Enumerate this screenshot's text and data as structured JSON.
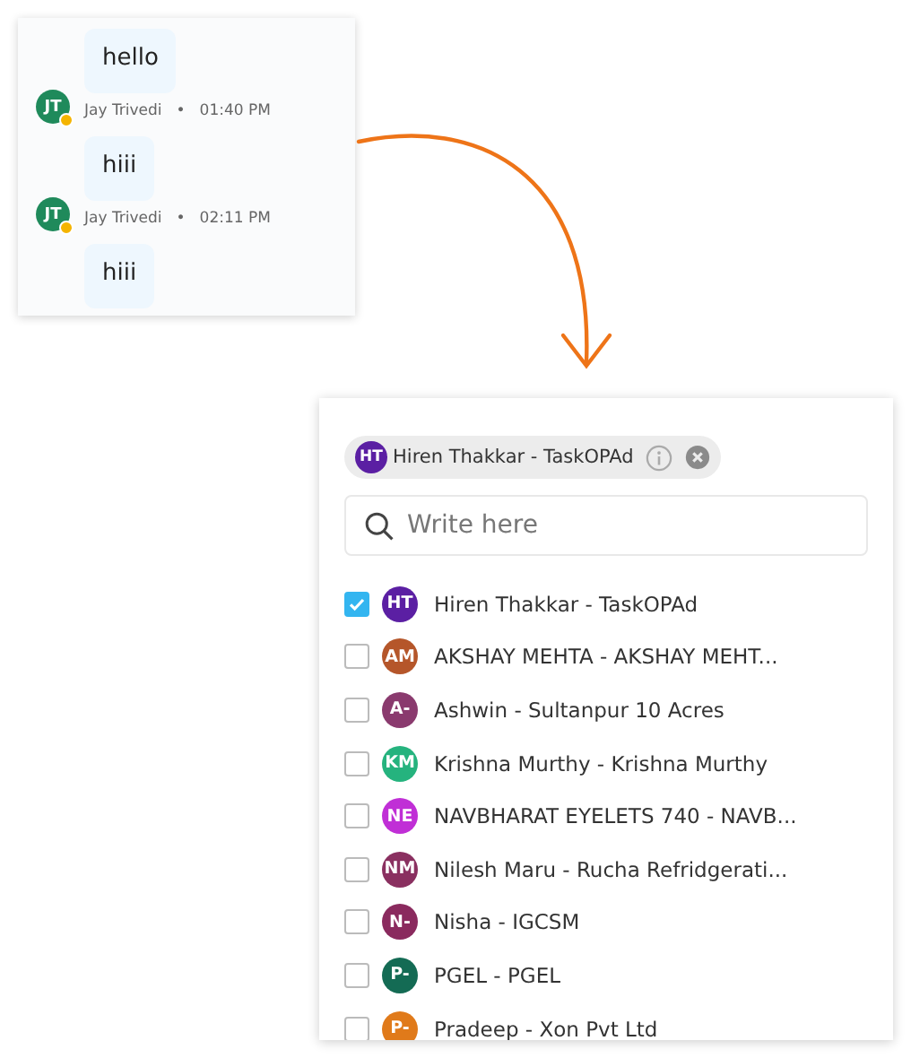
{
  "chat": {
    "messages": [
      {
        "text": "hello",
        "sender": {
          "initials": "JT",
          "name": "Jay Trivedi",
          "color": "#1f8a5b",
          "online": true
        },
        "separator": "•",
        "time": "01:40 PM"
      },
      {
        "text": "hiii",
        "sender": {
          "initials": "JT",
          "name": "Jay Trivedi",
          "color": "#1f8a5b",
          "online": true
        },
        "separator": "•",
        "time": "02:11 PM"
      },
      {
        "text": "hiii"
      }
    ]
  },
  "picker": {
    "chips": [
      {
        "initials": "HT",
        "label": "Hiren Thakkar - TaskOPAd",
        "color": "#5b1fa3"
      }
    ],
    "search": {
      "placeholder": "Write here"
    },
    "options": [
      {
        "initials": "HT",
        "label": "Hiren Thakkar - TaskOPAd",
        "color": "#5b1fa3",
        "checked": true
      },
      {
        "initials": "AM",
        "label": "AKSHAY MEHTA - AKSHAY MEHT...",
        "color": "#b5562a",
        "checked": false
      },
      {
        "initials": "A-",
        "label": "Ashwin - Sultanpur 10 Acres",
        "color": "#8a3a6e",
        "checked": false
      },
      {
        "initials": "KM",
        "label": "Krishna Murthy - Krishna Murthy",
        "color": "#25b37e",
        "checked": false
      },
      {
        "initials": "NE",
        "label": "NAVBHARAT EYELETS 740 - NAVB...",
        "color": "#c02fd6",
        "checked": false
      },
      {
        "initials": "NM",
        "label": "Nilesh Maru - Rucha Refridgerati...",
        "color": "#8a3060",
        "checked": false
      },
      {
        "initials": "N-",
        "label": "Nisha - IGCSM",
        "color": "#8a2a5e",
        "checked": false
      },
      {
        "initials": "P-",
        "label": "PGEL - PGEL",
        "color": "#146b54",
        "checked": false
      },
      {
        "initials": "P-",
        "label": "Pradeep - Xon Pvt Ltd",
        "color": "#e07a1a",
        "checked": false
      }
    ]
  }
}
